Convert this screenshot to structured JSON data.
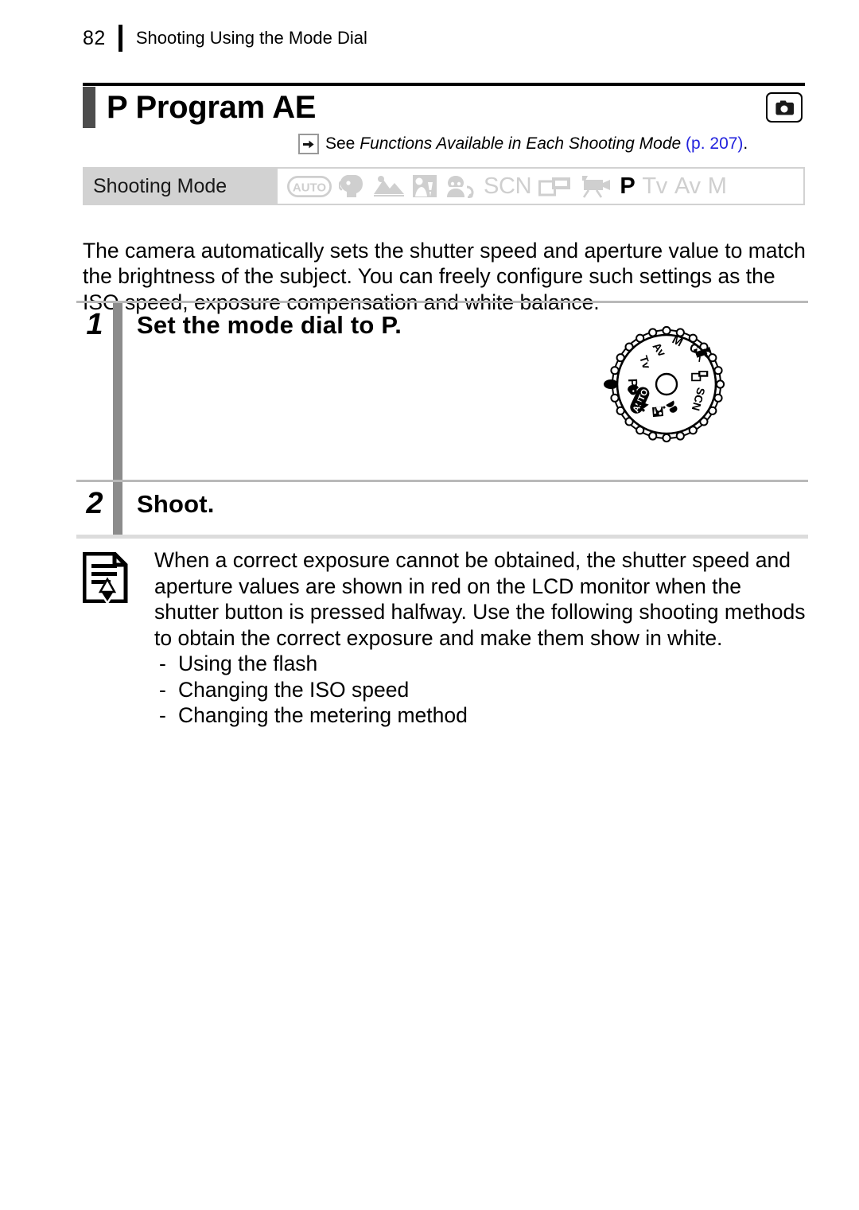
{
  "header": {
    "page_number": "82",
    "section_title": "Shooting Using the Mode Dial"
  },
  "title": {
    "text": "P Program AE",
    "icon": "camera-icon"
  },
  "see_reference": {
    "arrow_icon": "arrow-right-icon",
    "lead": "See",
    "emphasis": "Functions Available in Each Shooting Mode",
    "page_ref": "(p. 207)",
    "tail": ".",
    "link_color": "#2222dd"
  },
  "shooting_mode": {
    "label": "Shooting Mode",
    "modes": [
      {
        "name": "auto",
        "glyph": "AUTO",
        "kind": "auto",
        "active": false
      },
      {
        "name": "portrait",
        "glyph": "",
        "kind": "portrait",
        "active": false
      },
      {
        "name": "landscape",
        "glyph": "",
        "kind": "landscape",
        "active": false
      },
      {
        "name": "night-snapshot",
        "glyph": "",
        "kind": "night",
        "active": false
      },
      {
        "name": "kids-and-pets",
        "glyph": "",
        "kind": "kids",
        "active": false
      },
      {
        "name": "scene",
        "glyph": "SCN",
        "kind": "text",
        "active": false
      },
      {
        "name": "stitch-assist",
        "glyph": "",
        "kind": "stitch",
        "active": false
      },
      {
        "name": "movie",
        "glyph": "",
        "kind": "movie",
        "active": false
      },
      {
        "name": "program-ae",
        "glyph": "P",
        "kind": "text",
        "active": true
      },
      {
        "name": "shutter-priority",
        "glyph": "Tv",
        "kind": "text",
        "active": false
      },
      {
        "name": "aperture-priority",
        "glyph": "Av",
        "kind": "text",
        "active": false
      },
      {
        "name": "manual",
        "glyph": "M",
        "kind": "text",
        "active": false
      }
    ]
  },
  "intro_paragraph": "The camera automatically sets the shutter speed and aperture value to match the brightness of the subject. You can freely configure such settings as the ISO speed, exposure compensation and white balance.",
  "steps": [
    {
      "number": "1",
      "heading": "Set the mode dial to P.",
      "has_illustration": true
    },
    {
      "number": "2",
      "heading": "Shoot.",
      "has_illustration": false
    }
  ],
  "mode_dial": {
    "name": "mode-dial-illustration",
    "indicator": "position-marker",
    "labels": [
      "M",
      "Av",
      "Tv",
      "P",
      "AUTO",
      "SCN"
    ]
  },
  "note": {
    "icon": "note-pencil-icon",
    "body": "When a correct exposure cannot be obtained, the shutter speed and aperture values are shown in red on the LCD monitor when the shutter button is pressed halfway. Use the following shooting methods to obtain the correct exposure and make them show in white.",
    "bullet_marker": "-",
    "items": [
      "Using the flash",
      "Changing the ISO speed",
      "Changing the metering method"
    ]
  }
}
